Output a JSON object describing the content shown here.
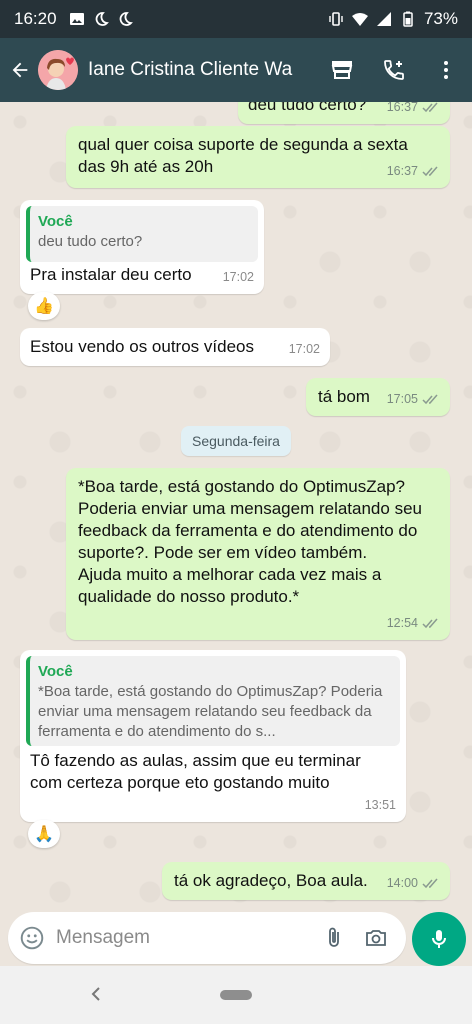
{
  "status_bar": {
    "time": "16:20",
    "battery": "73%",
    "icons": [
      "image-icon",
      "moon-icon",
      "moon-icon",
      "vibrate-icon",
      "wifi-icon",
      "signal-icon",
      "battery-icon"
    ]
  },
  "header": {
    "contact_name": "Iane Cristina Cliente Wa",
    "actions": [
      "store-icon",
      "add-call-icon",
      "more-vert-icon"
    ]
  },
  "messages": [
    {
      "id": "m0",
      "direction": "out",
      "text": "deu tudo certo?",
      "time": "16:37",
      "read": true,
      "partial": true
    },
    {
      "id": "m1",
      "direction": "out",
      "text": "qual quer coisa suporte de segunda a sexta das 9h até as 20h",
      "time": "16:37",
      "read": true
    },
    {
      "id": "m2",
      "direction": "in",
      "quote": {
        "author": "Você",
        "text": "deu tudo certo?"
      },
      "text": "Pra instalar deu certo",
      "time": "17:02",
      "reaction": "👍"
    },
    {
      "id": "m3",
      "direction": "in",
      "text": "Estou vendo os outros vídeos",
      "time": "17:02"
    },
    {
      "id": "m4",
      "direction": "out",
      "text": "tá bom",
      "time": "17:05",
      "read": true
    },
    {
      "id": "m5",
      "direction": "out",
      "text": "*Boa tarde, está gostando do OptimusZap? Poderia enviar uma mensagem relatando seu feedback da ferramenta e do atendimento do suporte?. Pode ser em vídeo também.\nAjuda muito a melhorar cada vez mais a qualidade do nosso produto.*",
      "time": "12:54",
      "read": true
    },
    {
      "id": "m6",
      "direction": "in",
      "quote": {
        "author": "Você",
        "text": "*Boa tarde, está gostando do OptimusZap? Poderia enviar uma mensagem relatando seu feedback da ferramenta e do atendimento do s..."
      },
      "text": "Tô fazendo as aulas, assim que eu terminar com certeza porque eto gostando muito",
      "time": "13:51",
      "reaction": "🙏"
    },
    {
      "id": "m7",
      "direction": "out",
      "text": "tá ok agradeço, Boa aula.",
      "time": "14:00",
      "read": true
    }
  ],
  "day_separator": "Segunda-feira",
  "composer": {
    "placeholder": "Mensagem"
  },
  "colors": {
    "header": "#2f4a52",
    "outgoing": "#dcf8c6",
    "incoming": "#ffffff",
    "accent": "#00a884",
    "quote_bar": "#1fa855"
  }
}
